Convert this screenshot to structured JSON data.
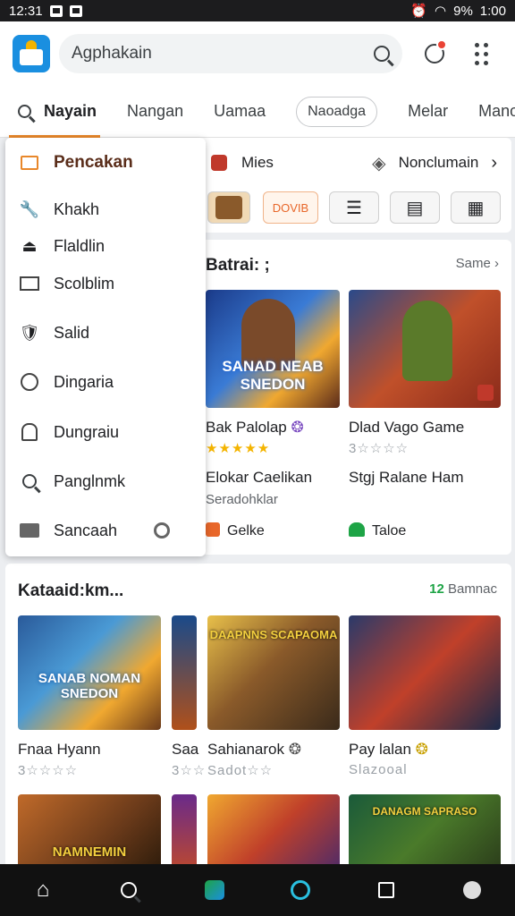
{
  "status_bar": {
    "time": "12:31",
    "battery": "9%",
    "clock_right": "1:00"
  },
  "search": {
    "text": "Agphakain"
  },
  "tabs": [
    {
      "label": "Nayain",
      "active": true
    },
    {
      "label": "Nangan"
    },
    {
      "label": "Uamaa"
    },
    {
      "label": "Naoadga",
      "pill": true
    },
    {
      "label": "Melar"
    },
    {
      "label": "Manon"
    }
  ],
  "menu": {
    "title": "Pencakan",
    "items": [
      {
        "label": "Khakh",
        "icon": "wrench-icon"
      },
      {
        "label": "Flaldlin",
        "icon": "upload-icon"
      },
      {
        "label": "Scolblim",
        "icon": "monitor-icon"
      },
      {
        "label": "Salid",
        "icon": "shield-icon"
      },
      {
        "label": "Dingaria",
        "icon": "clock-icon"
      },
      {
        "label": "Dungraiu",
        "icon": "archive-icon"
      },
      {
        "label": "Panglnmk",
        "icon": "search-icon"
      },
      {
        "label": "Sancaah",
        "icon": "folder-icon"
      }
    ]
  },
  "quick_row": {
    "left_label": "Mies",
    "right_label": "Nonclumain",
    "chip_label": "DOVIB"
  },
  "section1": {
    "title": "Batrai: ;",
    "more": "Same",
    "games": [
      {
        "name": "Bak Palolap",
        "stars": "★★★★★",
        "sub1": "Elokar Caelikan",
        "sub2": "Seradohklar",
        "footer": "Gelke"
      },
      {
        "name": "Dlad Vago Game",
        "stars": "3☆☆☆☆",
        "sub1": "Stgj Ralane Ham",
        "sub2": "",
        "footer": "Taloe"
      }
    ],
    "art_titles": [
      "SANAD NEAB SNEDON",
      ""
    ]
  },
  "section2": {
    "title": "Kataaid:km...",
    "more_count": "12",
    "more": "Bamnac",
    "games": [
      {
        "name": "Fnaa Hyann",
        "stars": "3☆☆☆☆"
      },
      {
        "name": "Saa",
        "stars": "3☆☆"
      },
      {
        "name": "Sahianarok",
        "stars": "Sadot☆☆"
      },
      {
        "name": "Pay lalan",
        "stars": "Slazooal"
      }
    ],
    "art_titles": [
      "SANAB NOMAN SNEDON",
      "DAAPNNS SCAPAOMA",
      "NAMNEMIN",
      "DANAGM SAPRASO"
    ]
  },
  "colors": {
    "accent": "#e8872a",
    "star": "#f4b400",
    "brand": "#1a8fe0"
  }
}
